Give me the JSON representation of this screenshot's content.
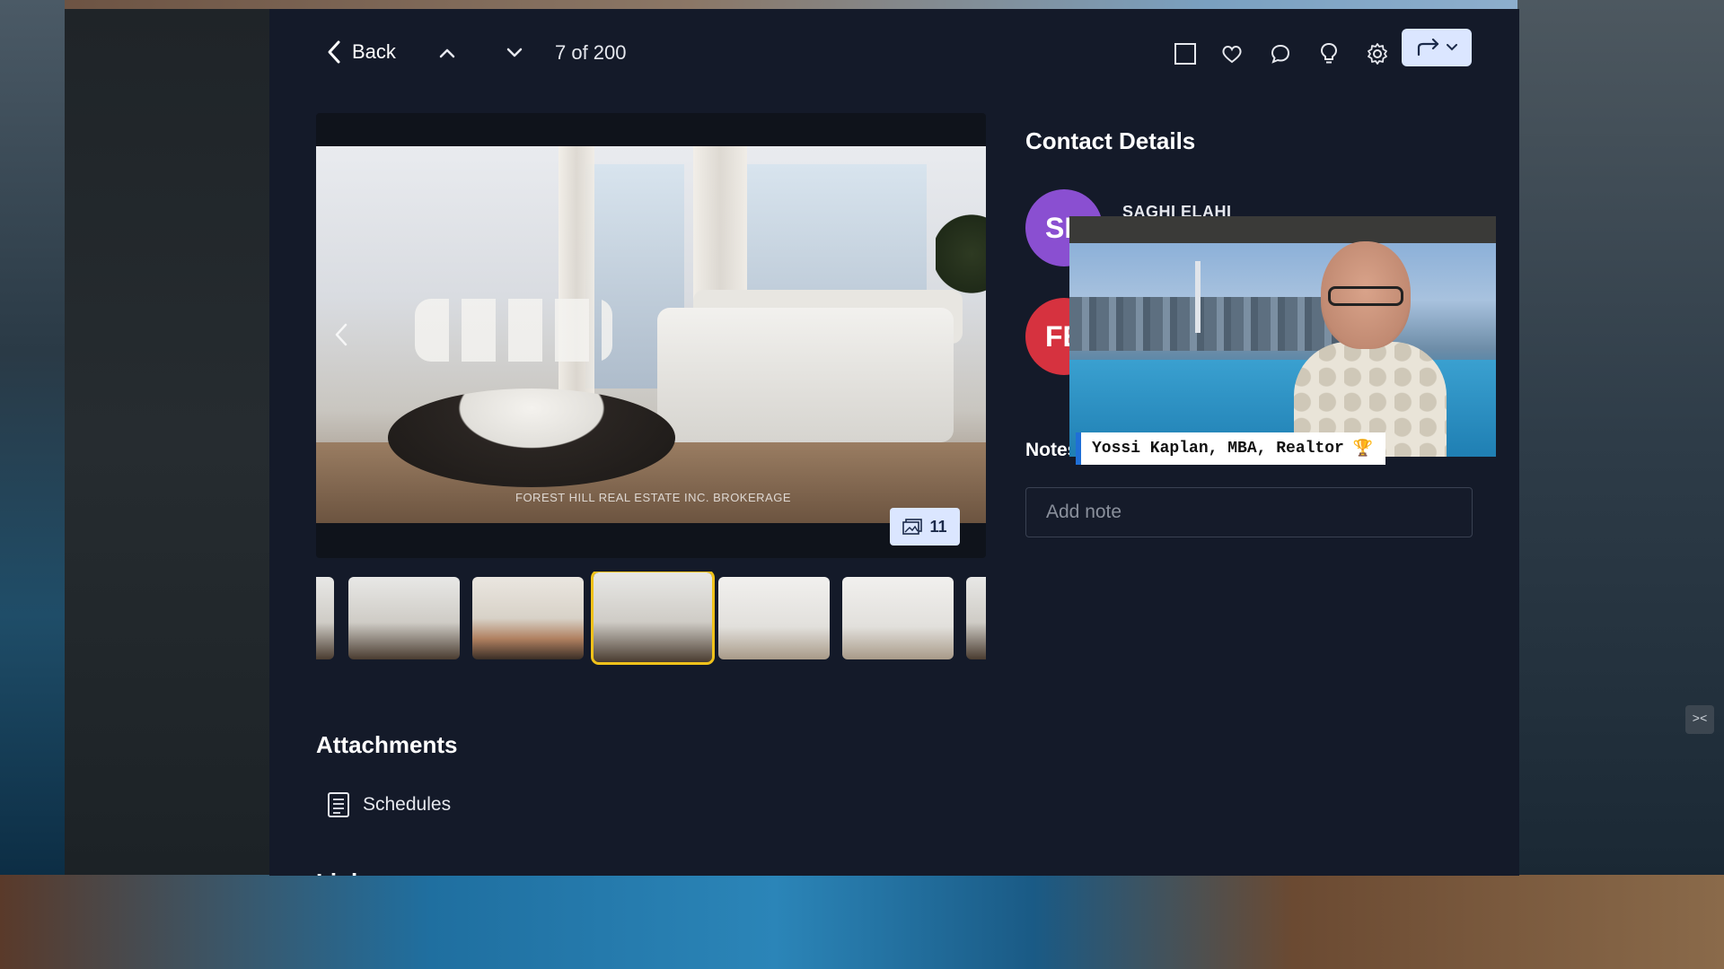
{
  "topbar": {
    "back_label": "Back",
    "counter": "7 of 200",
    "icons": [
      "checkbox-icon",
      "heart-icon",
      "comment-icon",
      "lightbulb-icon",
      "gear-icon",
      "share-icon",
      "chevron-down-icon"
    ]
  },
  "viewer": {
    "watermark": "FOREST HILL REAL ESTATE INC. BROKERAGE",
    "photo_count": "11",
    "thumbnails_count": 7,
    "selected_thumbnail": 4
  },
  "contact": {
    "title": "Contact Details",
    "person1_initials": "SE",
    "person1_name": "SAGHI ELAHI",
    "person2_initials": "FE",
    "notes_label": "Notes",
    "note_placeholder": "Add note"
  },
  "video_overlay": {
    "caption": "Yossi Kaplan, MBA, Realtor",
    "trophy": "🏆"
  },
  "attachments": {
    "title": "Attachments",
    "items": [
      {
        "label": "Schedules",
        "icon": "document-icon"
      }
    ]
  },
  "next_section_partial": "Links",
  "side_chip": "><",
  "colors": {
    "panel": "#141a29",
    "accent": "#dbe6ff",
    "selected_thumb": "#f0c21a",
    "avatar_purple": "#8a4fd1",
    "avatar_red": "#d6323f"
  }
}
